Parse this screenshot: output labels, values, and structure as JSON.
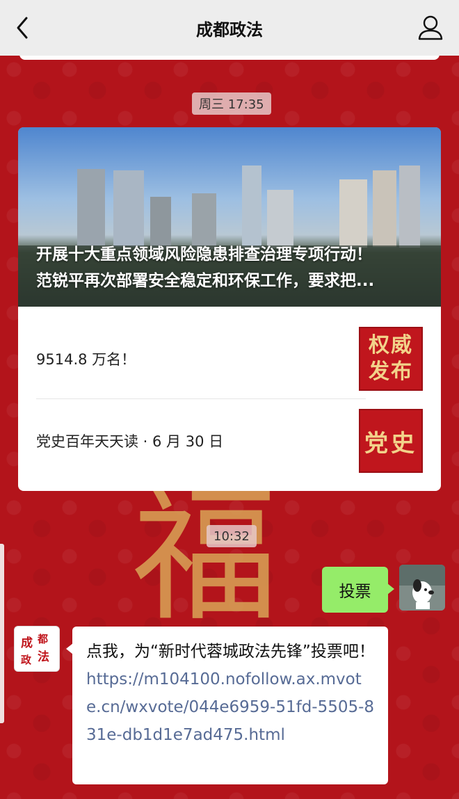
{
  "header": {
    "title": "成都政法",
    "back_icon": "chevron-left-icon",
    "profile_icon": "person-icon"
  },
  "timestamps": {
    "first": "周三 17:35",
    "second": "10:32"
  },
  "news_card": {
    "cover_title_line1": "开展十大重点领域风险隐患排查治理专项行动！",
    "cover_title_line2": "范锐平再次部署安全稳定和环保工作，要求把...",
    "items": [
      {
        "title": "9514.8 万名！",
        "thumb_line1": "权威",
        "thumb_line2": "发布"
      },
      {
        "title": "党史百年天天读 · 6 月 30 日",
        "thumb_text": "党史"
      }
    ]
  },
  "chat": {
    "my_message": "投票",
    "bot_avatar_text": "成都政法",
    "bot_message_text": "点我，为“新时代蓉城政法先锋”投票吧！",
    "bot_message_link": "https://m104100.nofollow.ax.mvote.cn/wxvote/044e6959-51fd-5505-831e-db1d1e7ad475.html"
  },
  "colors": {
    "background": "#b3141b",
    "header": "#ededed",
    "my_bubble": "#95ec69",
    "link": "#576b95"
  }
}
